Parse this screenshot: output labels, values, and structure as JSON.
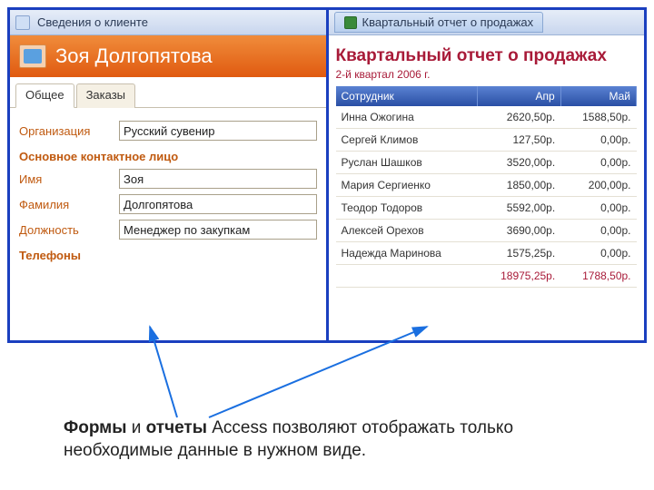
{
  "left": {
    "windowTitle": "Сведения о клиенте",
    "personName": "Зоя Долгопятова",
    "tabs": {
      "general": "Общее",
      "orders": "Заказы"
    },
    "labels": {
      "org": "Организация",
      "contactSection": "Основное контактное лицо",
      "firstName": "Имя",
      "lastName": "Фамилия",
      "position": "Должность",
      "phones": "Телефоны"
    },
    "values": {
      "org": "Русский сувенир",
      "firstName": "Зоя",
      "lastName": "Долгопятова",
      "position": "Менеджер по закупкам"
    }
  },
  "right": {
    "tabLabel": "Квартальный отчет о продажах",
    "title": "Квартальный отчет о продажах",
    "subtitle": "2-й квартал 2006 г.",
    "columns": {
      "employee": "Сотрудник",
      "apr": "Апр",
      "may": "Май"
    },
    "rows": [
      {
        "name": "Инна Ожогина",
        "apr": "2620,50р.",
        "may": "1588,50р."
      },
      {
        "name": "Сергей Климов",
        "apr": "127,50р.",
        "may": "0,00р."
      },
      {
        "name": "Руслан Шашков",
        "apr": "3520,00р.",
        "may": "0,00р."
      },
      {
        "name": "Мария Сергиенко",
        "apr": "1850,00р.",
        "may": "200,00р."
      },
      {
        "name": "Теодор Тодоров",
        "apr": "5592,00р.",
        "may": "0,00р."
      },
      {
        "name": "Алексей Орехов",
        "apr": "3690,00р.",
        "may": "0,00р."
      },
      {
        "name": "Надежда Маринова",
        "apr": "1575,25р.",
        "may": "0,00р."
      }
    ],
    "totals": {
      "apr": "18975,25р.",
      "may": "1788,50р."
    }
  },
  "caption": {
    "bold1": "Формы",
    "mid1": " и ",
    "bold2": "отчеты",
    "rest": " Access позволяют отображать только необходимые данные в нужном виде."
  }
}
